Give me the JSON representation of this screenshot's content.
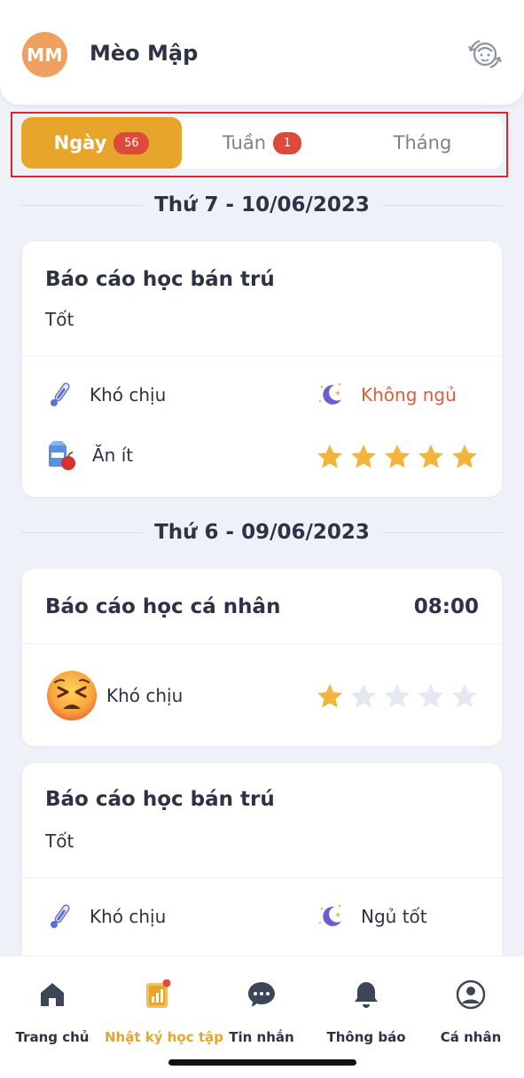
{
  "header": {
    "avatar_initials": "MM",
    "user_name": "Mèo Mập",
    "switch_icon": "child-switch-icon"
  },
  "tabs": [
    {
      "label": "Ngày",
      "badge": "56",
      "active": true
    },
    {
      "label": "Tuần",
      "badge": "1",
      "active": false
    },
    {
      "label": "Tháng",
      "badge": "",
      "active": false
    }
  ],
  "sections": [
    {
      "date": "Thứ 7 - 10/06/2023",
      "cards": [
        {
          "title": "Báo cáo học bán trú",
          "subtitle": "Tốt",
          "health": {
            "icon": "thermometer-icon",
            "text": "Khó chịu"
          },
          "sleep": {
            "icon": "moon-icon",
            "text": "Không ngủ",
            "color": "#e05a3c"
          },
          "meal": {
            "icon": "milk-apple-icon",
            "text": "Ăn ít"
          },
          "rating": 5
        }
      ]
    },
    {
      "date": "Thứ 6 - 09/06/2023",
      "cards": [
        {
          "title": "Báo cáo học cá nhân",
          "time": "08:00",
          "mood": {
            "icon": "tired-face-icon",
            "text": "Khó chịu"
          },
          "rating": 1
        },
        {
          "title": "Báo cáo học bán trú",
          "subtitle": "Tốt",
          "health": {
            "icon": "thermometer-icon",
            "text": "Khó chịu"
          },
          "sleep": {
            "icon": "moon-icon",
            "text": "Ngủ tốt"
          }
        }
      ]
    }
  ],
  "colors": {
    "accent": "#e7a52c",
    "badge": "#dd4a3a",
    "star_on": "#f2b43a",
    "star_off": "#e4e8ef"
  },
  "bottom_nav": [
    {
      "label": "Trang chủ",
      "icon": "home-icon",
      "active": false
    },
    {
      "label": "Nhật ký học tập",
      "icon": "study-journal-icon",
      "active": true
    },
    {
      "label": "Tin nhắn",
      "icon": "chat-icon",
      "active": false
    },
    {
      "label": "Thông báo",
      "icon": "bell-icon",
      "active": false
    },
    {
      "label": "Cá nhân",
      "icon": "user-icon",
      "active": false
    }
  ]
}
